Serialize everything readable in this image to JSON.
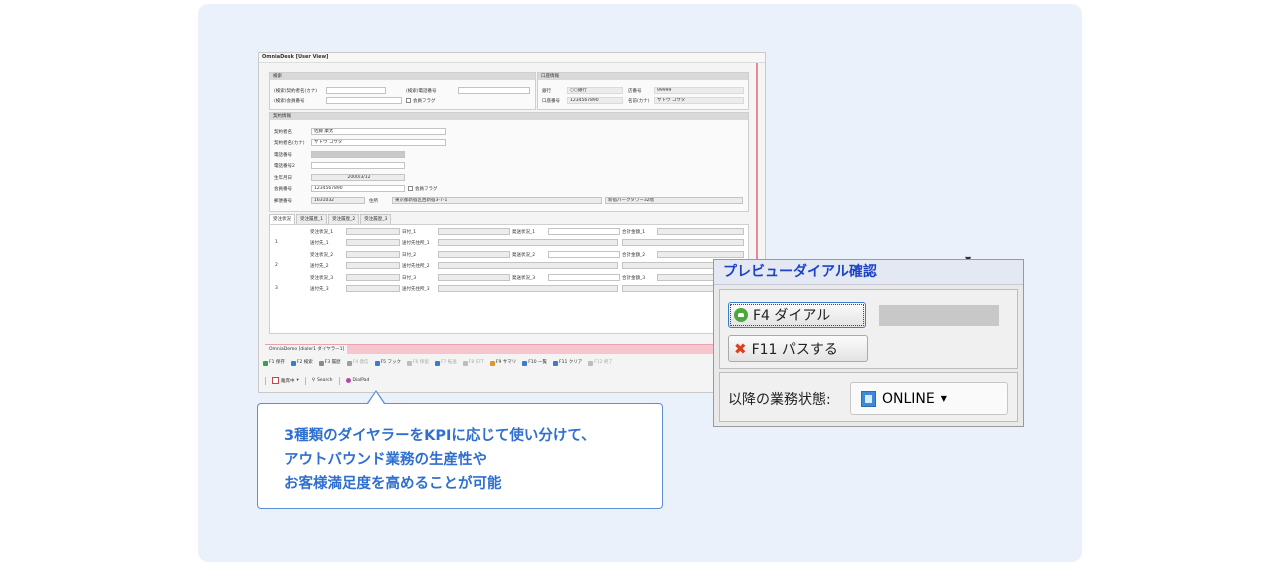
{
  "app": {
    "title": "OmniaDesk [User View]",
    "search": {
      "heading": "検索",
      "kana_label": "(検索)契約者名(カナ)",
      "phone_label": "(検索)電話番号",
      "member_label": "(検索)会員番号",
      "member_flag": "会員フラグ"
    },
    "bank": {
      "heading": "口座情報",
      "bank_label": "銀行",
      "bank_value": "○○銀行",
      "branch_label": "店番号",
      "branch_value": "99999",
      "account_label": "口座番号",
      "account_value": "1234567890",
      "holder_label": "名前(カナ)",
      "holder_value": "サトウ コウタ"
    },
    "contract": {
      "heading": "契約情報",
      "name_label": "契約者名",
      "name_value": "佐藤 康太",
      "kana_label": "契約者名(カナ)",
      "kana_value": "サトウ コウタ",
      "phone_label": "電話番号",
      "phone2_label": "電話番号2",
      "birth_label": "生年月日",
      "birth_value": "2000/3/12",
      "member_label": "会員番号",
      "member_value": "1234567890",
      "member_flag": "会員フラグ",
      "zip_label": "郵便番号",
      "zip_value": "1631032",
      "address_label": "住所",
      "address_value": "東京都新宿区西新宿3-7-1",
      "address2_value": "新宿パークタワー32階"
    },
    "tabs": [
      "受注状況",
      "受注履歴_1",
      "受注履歴_2",
      "受注履歴_3"
    ],
    "orders": [
      {
        "num": "1",
        "status": "受注状況_1",
        "dest": "送付先_1",
        "date": "日付_1",
        "dest_addr": "送付先住所_1",
        "ship": "発送状況_1",
        "total": "合計金額_1"
      },
      {
        "num": "2",
        "status": "受注状況_2",
        "dest": "送付先_2",
        "date": "日付_2",
        "dest_addr": "送付先住所_2",
        "ship": "発送状況_2",
        "total": "合計金額_2"
      },
      {
        "num": "3",
        "status": "受注状況_3",
        "dest": "送付先_3",
        "date": "日付_3",
        "dest_addr": "送付先住所_3",
        "ship": "発送状況_3",
        "total": "合計金額_3"
      }
    ],
    "statusbar": "OmniaDemo [dialer1 ダイヤラー1]",
    "fkeys": [
      {
        "label": "F1 保存",
        "color": "#3aa04a",
        "enabled": true
      },
      {
        "label": "F2 検索",
        "color": "#3b7bd4",
        "enabled": true
      },
      {
        "label": "F3 履歴",
        "color": "#8a8a8a",
        "enabled": true
      },
      {
        "label": "F4 発信",
        "color": "#9e9e9e",
        "enabled": false
      },
      {
        "label": "F5 フック",
        "color": "#3b7bd4",
        "enabled": true
      },
      {
        "label": "F6 保留",
        "color": "#bdbdbd",
        "enabled": false
      },
      {
        "label": "F7 転送",
        "color": "#3b7bd4",
        "enabled": false
      },
      {
        "label": "F8 STT",
        "color": "#bdbdbd",
        "enabled": false
      },
      {
        "label": "F9 サマリ",
        "color": "#e0962c",
        "enabled": true
      },
      {
        "label": "F10 一覧",
        "color": "#3b7bd4",
        "enabled": true
      },
      {
        "label": "F11 クリア",
        "color": "#3b7bd4",
        "enabled": true
      },
      {
        "label": "F12 終了",
        "color": "#bdbdbd",
        "enabled": false
      }
    ],
    "tools": {
      "state": "離席中",
      "search": "Search",
      "dialpad": "DialPad"
    }
  },
  "callout": {
    "line1": "3種類のダイヤラーをKPIに応じて使い分けて、",
    "line2": "アウトバウンド業務の生産性や",
    "line3": "お客様満足度を高めることが可能"
  },
  "dialog": {
    "title": "プレビューダイアル確認",
    "dial_button": "F4 ダイアル",
    "pass_button": "F11 パスする",
    "next_state_label": "以降の業務状態:",
    "state_value": "ONLINE"
  }
}
